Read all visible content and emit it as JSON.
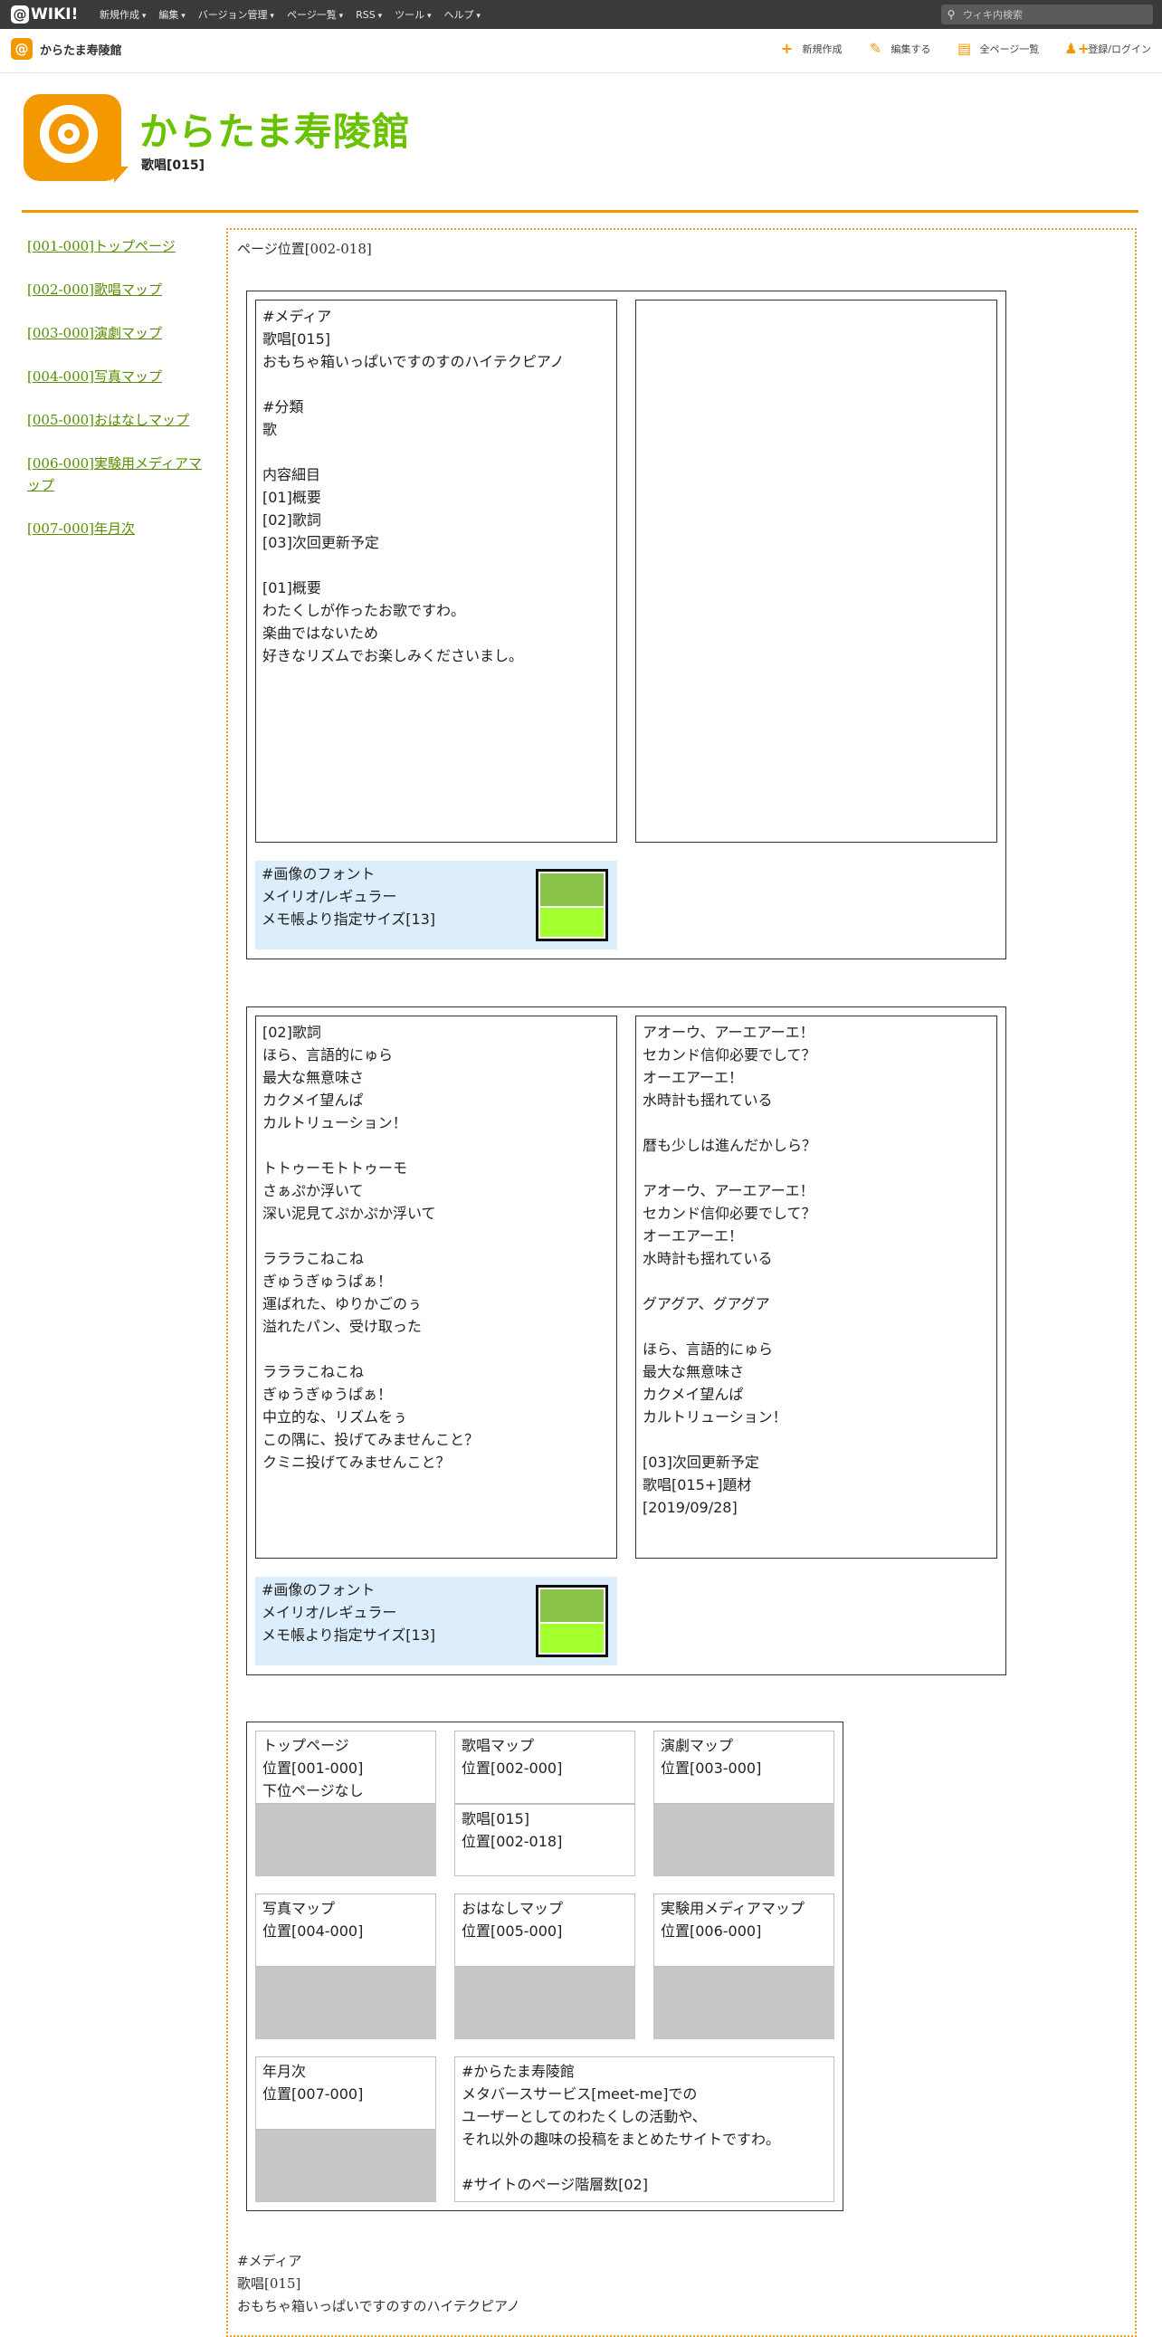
{
  "topbar": {
    "logo": "WIKI!",
    "menu": [
      "新規作成",
      "編集",
      "バージョン管理",
      "ページ一覧",
      "RSS",
      "ツール",
      "ヘルプ"
    ],
    "search_placeholder": "ウィキ内検索"
  },
  "subbar": {
    "site_name": "からたま寿陵館",
    "actions": [
      {
        "label": "新規作成",
        "icon": "plus-icon"
      },
      {
        "label": "編集する",
        "icon": "pencil-icon"
      },
      {
        "label": "全ページ一覧",
        "icon": "document-icon"
      },
      {
        "label": "登録/ログイン",
        "icon": "user-add-icon"
      }
    ]
  },
  "header": {
    "title": "からたま寿陵館",
    "subtitle": "歌唱[015]"
  },
  "sidebar": {
    "links": [
      "[001-000]トップページ",
      "[002-000]歌唱マップ",
      "[003-000]演劇マップ",
      "[004-000]写真マップ",
      "[005-000]おはなしマップ",
      "[006-000]実験用メディアマップ",
      "[007-000]年月次"
    ]
  },
  "main": {
    "location": "ページ位置[002-018]",
    "panel1": {
      "left_text": "#メディア\n歌唱[015]\nおもちゃ箱いっぱいですのすのハイテクピアノ\n\n#分類\n歌\n\n内容細目\n[01]概要\n[02]歌詞\n[03]次回更新予定\n\n[01]概要\nわたくしが作ったお歌ですわ。\n楽曲ではないため\n好きなリズムでお楽しみくださいまし。",
      "right_text": "",
      "font_info": "#画像のフォント\nメイリオ/レギュラー\nメモ帳より指定サイズ[13]"
    },
    "panel2": {
      "left_text": "[02]歌詞\nほら、言語的にゅら\n最大な無意味さ\nカクメイ望んぱ\nカルトリューション！\n\nトトゥーモトトゥーモ\nさぁぷか浮いて\n深い泥見てぷかぷか浮いて\n\nラララこねこね\nぎゅうぎゅうぱぁ！\n運ばれた、ゆりかごのぅ\n溢れたパン、受け取った\n\nラララこねこね\nぎゅうぎゅうぱぁ！\n中立的な、リズムをぅ\nこの隅に、投げてみませんこと？\nクミニ投げてみませんこと？",
      "right_text": "アオーウ、アーエアーエ！\nセカンド信仰必要でして？\nオーエアーエ！\n水時計も揺れている\n\n暦も少しは進んだかしら？\n\nアオーウ、アーエアーエ！\nセカンド信仰必要でして？\nオーエアーエ！\n水時計も揺れている\n\nグアグア、グアグア\n\nほら、言語的にゅら\n最大な無意味さ\nカクメイ望んぱ\nカルトリューション！\n\n[03]次回更新予定\n歌唱[015+]題材\n[2019/09/28]",
      "font_info": "#画像のフォント\nメイリオ/レギュラー\nメモ帳より指定サイズ[13]"
    },
    "swatch_colors": {
      "top": "#8bc34a",
      "bottom": "#a4ff2e"
    },
    "nav": {
      "top": "トップページ\n位置[001-000]\n下位ページなし",
      "uta_map": "歌唱マップ\n位置[002-000]",
      "uta_current": "歌唱[015]\n位置[002-018]",
      "engeki": "演劇マップ\n位置[003-000]",
      "shashin": "写真マップ\n位置[004-000]",
      "ohanashi": "おはなしマップ\n位置[005-000]",
      "jikken": "実験用メディアマップ\n位置[006-000]",
      "nengetsu": "年月次\n位置[007-000]",
      "about": "#からたま寿陵館\nメタバースサービス[meet-me]での\nユーザーとしてのわたくしの活動や、\nそれ以外の趣味の投稿をまとめたサイトですわ。\n\n#サイトのページ階層数[02]"
    },
    "footer_text": "#メディア\n歌唱[015]\nおもちゃ箱いっぱいですのすのハイテクピアノ"
  }
}
